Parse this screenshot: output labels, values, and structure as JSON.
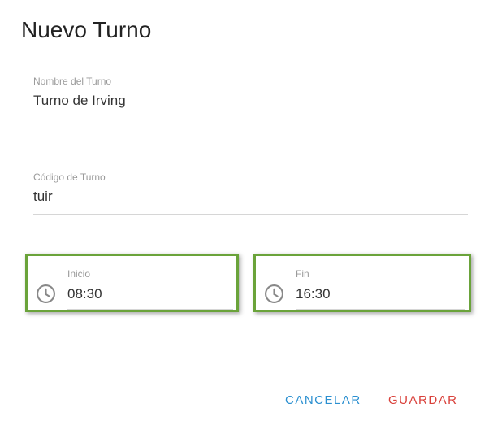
{
  "dialog": {
    "title": "Nuevo Turno"
  },
  "fields": {
    "name": {
      "label": "Nombre del Turno",
      "value": "Turno de Irving"
    },
    "code": {
      "label": "Código de Turno",
      "value": "tuir"
    }
  },
  "time": {
    "start": {
      "label": "Inicio",
      "value": "08:30",
      "icon": "clock-icon"
    },
    "end": {
      "label": "Fin",
      "value": "16:30",
      "icon": "clock-icon"
    }
  },
  "actions": {
    "cancel_label": "CANCELAR",
    "save_label": "GUARDAR"
  },
  "colors": {
    "highlight": "#6aa33a",
    "cancel": "#2a8fd0",
    "save": "#d9403a"
  }
}
